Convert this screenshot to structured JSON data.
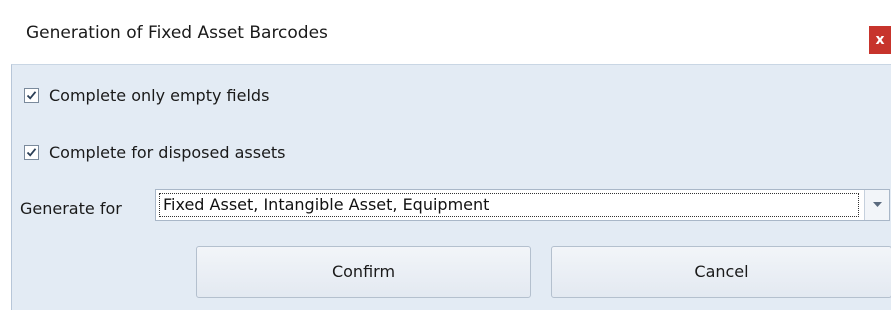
{
  "window": {
    "title": "Generation of Fixed Asset Barcodes",
    "close_label": "x"
  },
  "options": {
    "complete_empty_label": "Complete only empty fields",
    "complete_empty_checked": true,
    "complete_disposed_label": "Complete for disposed assets",
    "complete_disposed_checked": true
  },
  "generate": {
    "label": "Generate for",
    "value": "Fixed Asset, Intangible Asset, Equipment"
  },
  "buttons": {
    "confirm_label": "Confirm",
    "cancel_label": "Cancel"
  },
  "colors": {
    "panel_bg": "#e3ebf4",
    "close_bg": "#c7342c"
  },
  "icons": {
    "close": "close-icon",
    "check": "checkmark-icon",
    "dropdown": "chevron-down-icon"
  }
}
